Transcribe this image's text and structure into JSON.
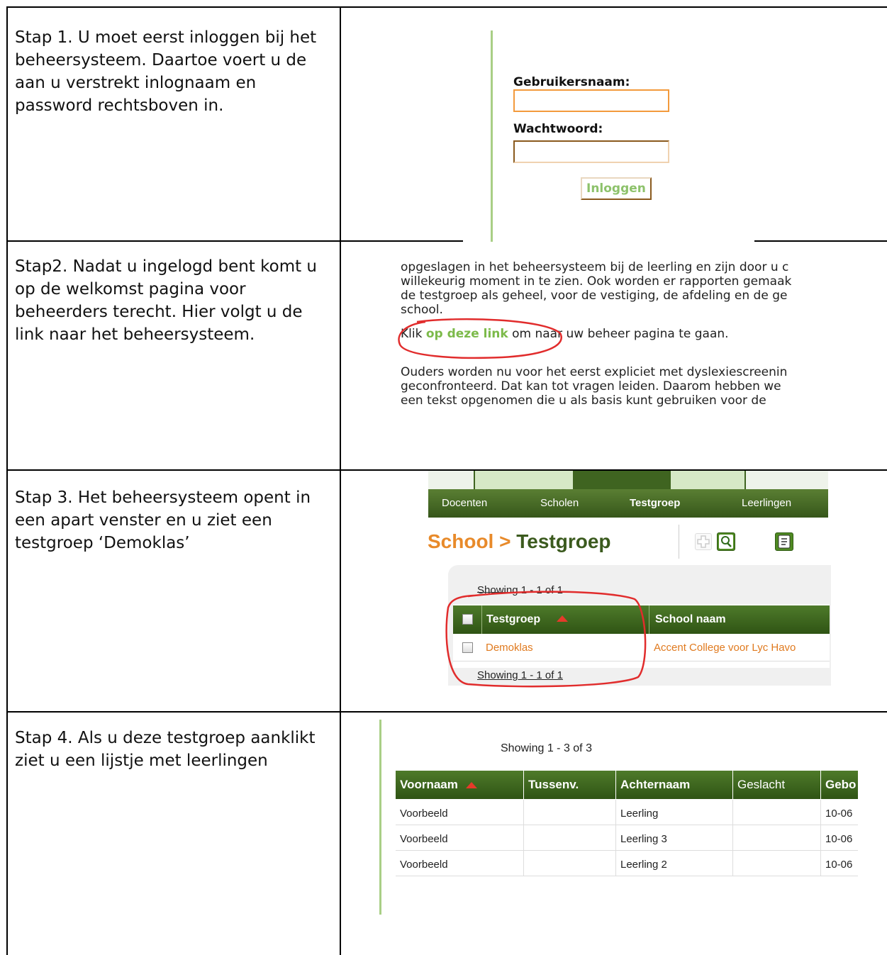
{
  "steps": [
    {
      "text": "Stap 1. U moet eerst inloggen bij het beheersysteem. Daartoe voert u de aan u verstrekt inlognaam en password rechtsboven in."
    },
    {
      "text": "Stap2. Nadat u ingelogd bent komt u op de welkomst pagina voor beheerders terecht. Hier volgt u de link naar het beheersysteem."
    },
    {
      "text": "Stap 3. Het beheersysteem opent in een apart venster en u ziet een testgroep ‘Demoklas’"
    },
    {
      "text": "Stap 4. Als u deze testgroep aanklikt ziet u een lijstje met leerlingen"
    }
  ],
  "login": {
    "username_label": "Gebruikersnaam:",
    "password_label": "Wachtwoord:",
    "username_value": "",
    "password_value": "",
    "button_label": "Inloggen"
  },
  "welcome": {
    "line1": "opgeslagen in het beheersysteem bij de leerling en zijn door u c",
    "line2": "willekeurig moment in te zien. Ook worden er rapporten gemaak",
    "line3": "de testgroep als geheel, voor de vestiging, de afdeling en de ge",
    "line4": "school.",
    "link_prefix": "Klik ",
    "link_text": "op deze link",
    "link_suffix": " om naar uw beheer pagina te gaan.",
    "line5": "Ouders worden nu voor het eerst expliciet met dyslexiescreenin",
    "line6": "geconfronteerd. Dat kan tot vragen leiden. Daarom hebben we",
    "line7": "een tekst opgenomen die u als basis kunt gebruiken voor de"
  },
  "admin": {
    "nav": [
      "Docenten",
      "Scholen",
      "Testgroep",
      "Leerlingen"
    ],
    "active_nav": "Testgroep",
    "breadcrumb_school": "School",
    "breadcrumb_sep": ">",
    "breadcrumb_page": "Testgroep",
    "showing_top": "Showing 1 - 1 of 1",
    "showing_bottom": "Showing 1 - 1 of 1",
    "columns": [
      "Testgroep",
      "School naam"
    ],
    "row": {
      "testgroep": "Demoklas",
      "school": "Accent College voor Lyc Havo"
    },
    "colors": {
      "nav": "#3f6420",
      "breadcrumb_school": "#e88a2a",
      "breadcrumb_page": "#3b5a1e",
      "link": "#e07a1f",
      "highlight": "#d22"
    }
  },
  "students": {
    "showing": "Showing 1 - 3 of 3",
    "columns": [
      "Voornaam",
      "Tussenv.",
      "Achternaam",
      "Geslacht",
      "Gebo"
    ],
    "rows": [
      {
        "voornaam": "Voorbeeld",
        "tussenv": "",
        "achternaam": "Leerling",
        "geslacht": "",
        "geboorte": "10-06"
      },
      {
        "voornaam": "Voorbeeld",
        "tussenv": "",
        "achternaam": "Leerling 3",
        "geslacht": "",
        "geboorte": "10-06"
      },
      {
        "voornaam": "Voorbeeld",
        "tussenv": "",
        "achternaam": "Leerling 2",
        "geslacht": "",
        "geboorte": "10-06"
      }
    ]
  }
}
